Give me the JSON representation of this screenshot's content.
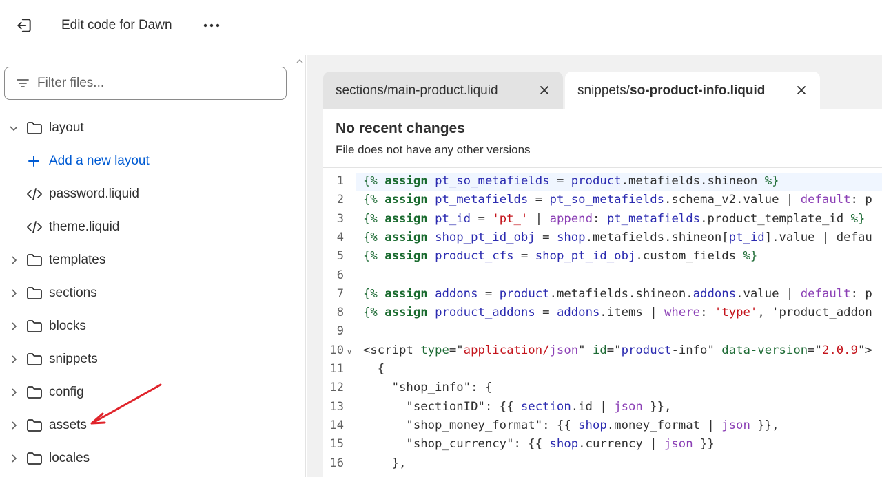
{
  "header": {
    "title": "Edit code for Dawn",
    "exit_icon": "exit-icon",
    "more_icon": "more-horizontal-icon"
  },
  "sidebar": {
    "filter_placeholder": "Filter files...",
    "tree": [
      {
        "type": "folder",
        "label": "layout",
        "expanded": true
      },
      {
        "type": "action",
        "label": "Add a new layout"
      },
      {
        "type": "file",
        "label": "password.liquid"
      },
      {
        "type": "file",
        "label": "theme.liquid"
      },
      {
        "type": "folder",
        "label": "templates",
        "expanded": false
      },
      {
        "type": "folder",
        "label": "sections",
        "expanded": false
      },
      {
        "type": "folder",
        "label": "blocks",
        "expanded": false
      },
      {
        "type": "folder",
        "label": "snippets",
        "expanded": false
      },
      {
        "type": "folder",
        "label": "config",
        "expanded": false
      },
      {
        "type": "folder",
        "label": "assets",
        "expanded": false
      },
      {
        "type": "folder",
        "label": "locales",
        "expanded": false
      }
    ]
  },
  "tabs": [
    {
      "prefix": "sections/main-product.liquid",
      "bold": "",
      "active": false
    },
    {
      "prefix": "snippets/",
      "bold": "so-product-info.liquid",
      "active": true
    }
  ],
  "notice": {
    "title": "No recent changes",
    "subtitle": "File does not have any other versions"
  },
  "editor": {
    "active_line": 1,
    "line_numbers": [
      "1",
      "2",
      "3",
      "4",
      "5",
      "6",
      "7",
      "8",
      "9",
      "10",
      "11",
      "12",
      "13",
      "14",
      "15",
      "16"
    ],
    "lines": [
      "{% assign pt_so_metafields = product.metafields.shineon %}",
      "{% assign pt_metafields = pt_so_metafields.schema_v2.value | default: p",
      "{% assign pt_id = 'pt_' | append: pt_metafields.product_template_id %}",
      "{% assign shop_pt_id_obj = shop.metafields.shineon[pt_id].value | defau",
      "{% assign product_cfs = shop_pt_id_obj.custom_fields %}",
      "",
      "{% assign addons = product.metafields.shineon.addons.value | default: p",
      "{% assign product_addons = addons.items | where: 'type', 'product_addon",
      "",
      "<script type=\"application/json\" id=\"product-info\" data-version=\"2.0.9\">",
      "  {",
      "    \"shop_info\": {",
      "      \"sectionID\": {{ section.id | json }},",
      "      \"shop_money_format\": {{ shop.money_format | json }},",
      "      \"shop_currency\": {{ shop.currency | json }}",
      "    },"
    ]
  },
  "colors": {
    "accent_link": "#005bd3",
    "annotation_arrow": "#e0242b"
  }
}
